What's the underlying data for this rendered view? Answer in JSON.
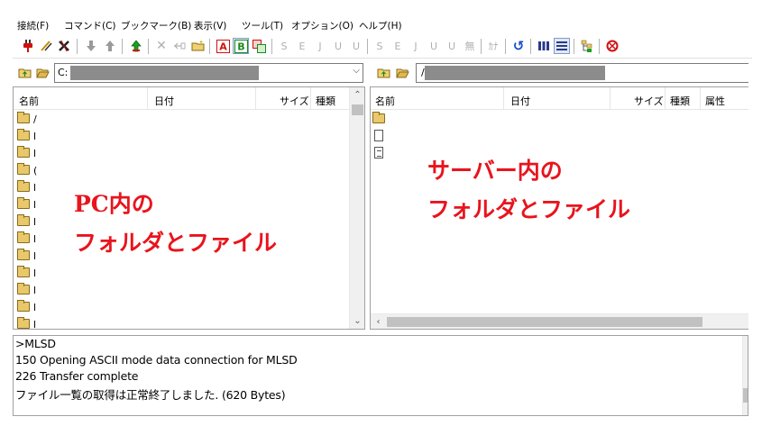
{
  "menu": [
    "接続(F)",
    "コマンド(C)",
    "ブックマーク(B)",
    "表示(V)",
    "ツール(T)",
    "オプション(O)",
    "ヘルプ(H)"
  ],
  "toolbar": {
    "kanji_labels": [
      "S",
      "E",
      "J",
      "U",
      "U",
      "S",
      "E",
      "J",
      "U",
      "U",
      "無",
      "ｶﾅ"
    ],
    "ascii_label": "A",
    "binary_label": "B"
  },
  "left_pane": {
    "path": "C:",
    "columns": [
      "名前",
      "日付",
      "サイズ",
      "種類"
    ],
    "rows": [
      {
        "icon": "folder-icon",
        "name": "/"
      },
      {
        "icon": "folder-icon",
        "name": "l"
      },
      {
        "icon": "folder-icon",
        "name": "l"
      },
      {
        "icon": "folder-icon",
        "name": "("
      },
      {
        "icon": "folder-icon",
        "name": "l"
      },
      {
        "icon": "folder-icon",
        "name": "l"
      },
      {
        "icon": "folder-icon",
        "name": "l"
      },
      {
        "icon": "folder-icon",
        "name": "l"
      },
      {
        "icon": "folder-icon",
        "name": "l"
      },
      {
        "icon": "folder-icon",
        "name": "l"
      },
      {
        "icon": "folder-icon",
        "name": "l"
      },
      {
        "icon": "folder-icon",
        "name": "l"
      },
      {
        "icon": "folder-icon",
        "name": "l"
      }
    ],
    "overlay_line1": "PC内の",
    "overlay_line2": "フォルダとファイル"
  },
  "right_pane": {
    "path": "/",
    "columns": [
      "名前",
      "日付",
      "サイズ",
      "種類",
      "属性"
    ],
    "rows": [
      {
        "icon": "folder-icon",
        "name": ""
      },
      {
        "icon": "file-icon",
        "name": ""
      },
      {
        "icon": "text-file-icon",
        "name": ""
      }
    ],
    "overlay_line1": "サーバー内の",
    "overlay_line2": "フォルダとファイル"
  },
  "log": [
    ">MLSD",
    "150 Opening ASCII mode data connection for MLSD",
    "226 Transfer complete",
    "ファイル一覧の取得は正常終了しました. (620 Bytes)"
  ],
  "colors": {
    "overlay": "#e8141d",
    "folder": "#e8c86a"
  }
}
